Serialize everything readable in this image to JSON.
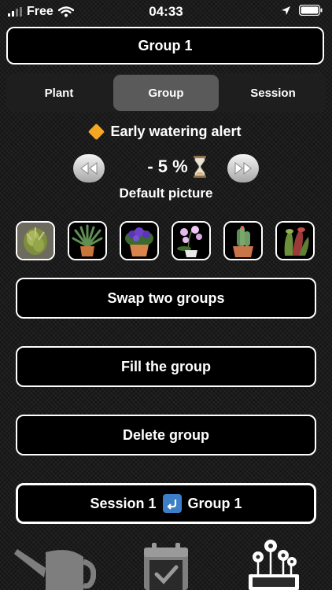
{
  "status_bar": {
    "carrier": "Free",
    "time": "04:33"
  },
  "header": {
    "title": "Group 1"
  },
  "tabs": [
    {
      "label": "Plant",
      "selected": false
    },
    {
      "label": "Group",
      "selected": true
    },
    {
      "label": "Session",
      "selected": false
    }
  ],
  "alert": {
    "label": "Early watering alert"
  },
  "adjuster": {
    "value": "- 5 %"
  },
  "default_picture_label": "Default picture",
  "thumbnails": [
    "cannabis",
    "aloe",
    "african-violet",
    "orchid",
    "cactus",
    "pitcher-plant"
  ],
  "actions": {
    "swap": "Swap two groups",
    "fill": "Fill the group",
    "delete": "Delete group"
  },
  "session_link": {
    "session": "Session 1",
    "group": "Group 1"
  },
  "bottom_nav": [
    "watering-can-icon",
    "calendar-check-icon",
    "flowers-icon"
  ]
}
